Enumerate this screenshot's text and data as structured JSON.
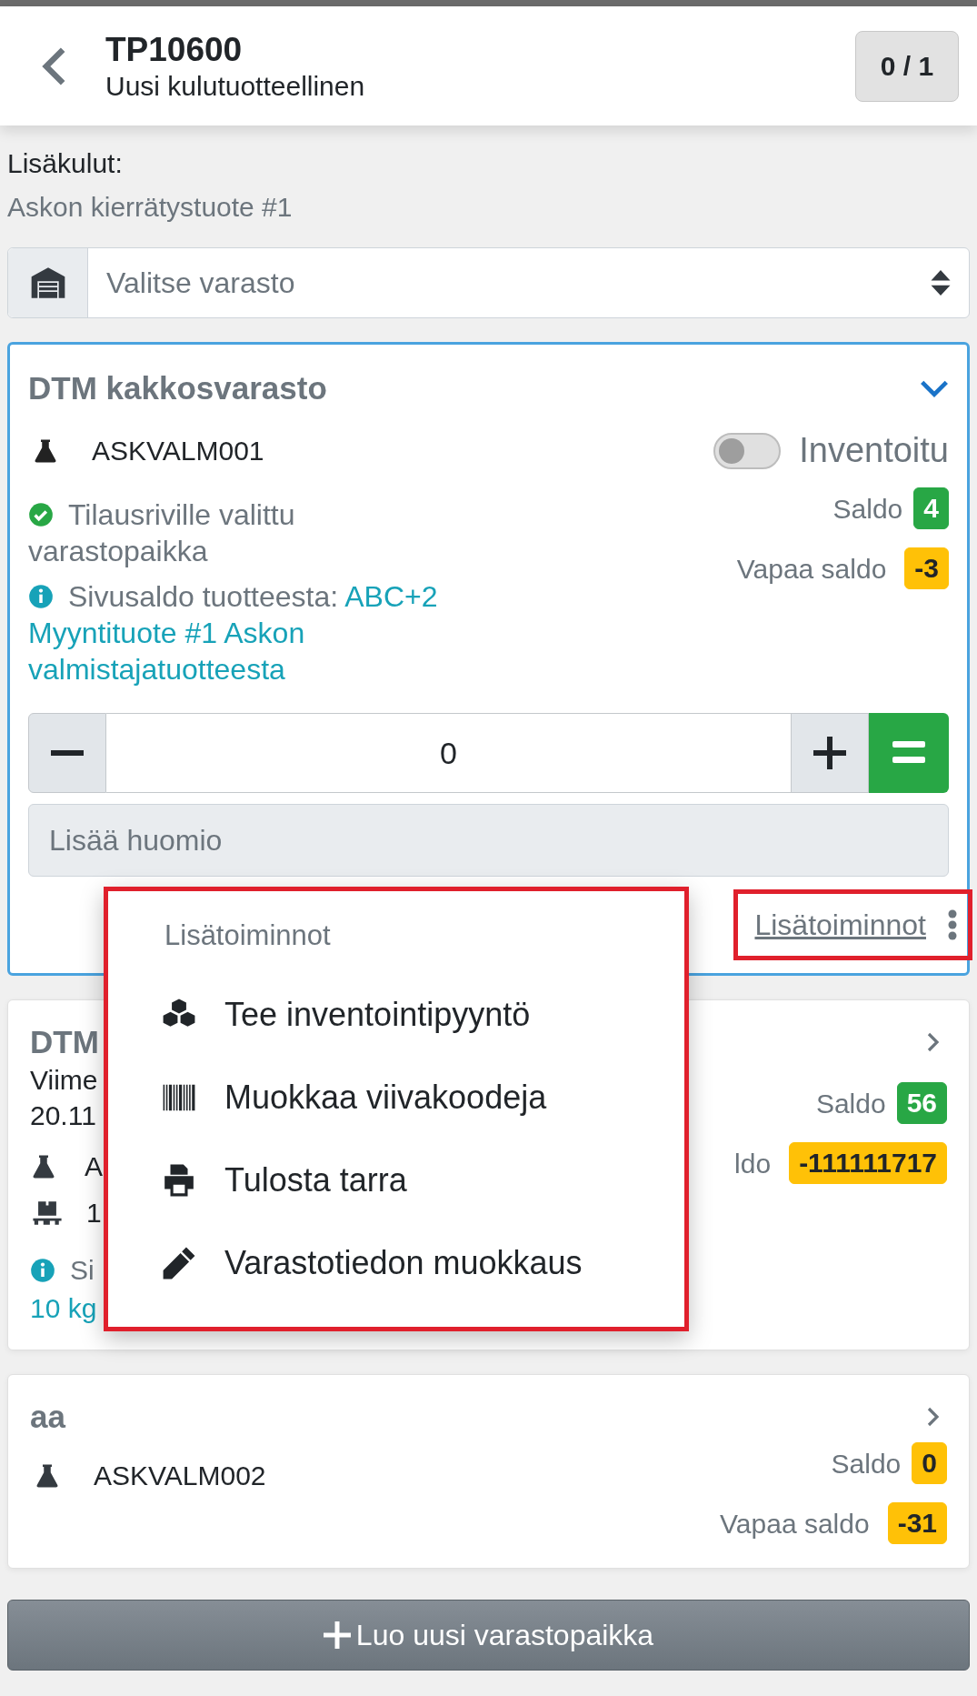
{
  "header": {
    "title": "TP10600",
    "subtitle": "Uusi kulutuotteellinen",
    "counter": "0 / 1"
  },
  "extra_costs": {
    "label": "Lisäkulut:",
    "value": "Askon kierrätystuote #1"
  },
  "warehouse_select": {
    "placeholder": "Valitse varasto"
  },
  "locations": [
    {
      "kind": "expanded",
      "name": "DTM kakkosvarasto",
      "product": "ASKVALM001",
      "inventoried": {
        "label": "Inventoitu",
        "on": false
      },
      "status": "Tilausriville valittu varastopaikka",
      "side_balance_label": "Sivusaldo tuotteesta: ",
      "side_balance_value": "ABC+2 Myyntituote #1 Askon valmistajatuotteesta",
      "balance_label": "Saldo",
      "balance": {
        "value": "4",
        "color": "#28a745"
      },
      "free_label": "Vapaa saldo",
      "free_balance": {
        "value": "-3",
        "color": "#ffc107"
      },
      "quantity": "0",
      "note": {
        "placeholder": "Lisää huomio"
      },
      "more_actions": "Lisätoiminnot"
    },
    {
      "kind": "covered",
      "name": "DTM",
      "lines": [
        "Viime",
        "20.11"
      ],
      "product": "A",
      "pallet": "1",
      "info": "Si",
      "info_value": "10 kg",
      "balance_label": "Saldo",
      "balance": {
        "value": "56",
        "color": "#28a745"
      },
      "free_label": "ldo",
      "free_balance": {
        "value": "-111111717",
        "color": "#ffc107"
      }
    },
    {
      "kind": "collapsed",
      "name": "aa",
      "product": "ASKVALM002",
      "balance_label": "Saldo",
      "balance": {
        "value": "0",
        "color": "#ffc107"
      },
      "free_label": "Vapaa saldo",
      "free_balance": {
        "value": "-31",
        "color": "#ffc107"
      }
    }
  ],
  "menu": {
    "title": "Lisätoiminnot",
    "items": [
      "Tee inventointipyyntö",
      "Muokkaa viivakoodeja",
      "Tulosta tarra",
      "Varastotiedon muokkaus"
    ]
  },
  "create_button": "Luo uusi varastopaikka"
}
